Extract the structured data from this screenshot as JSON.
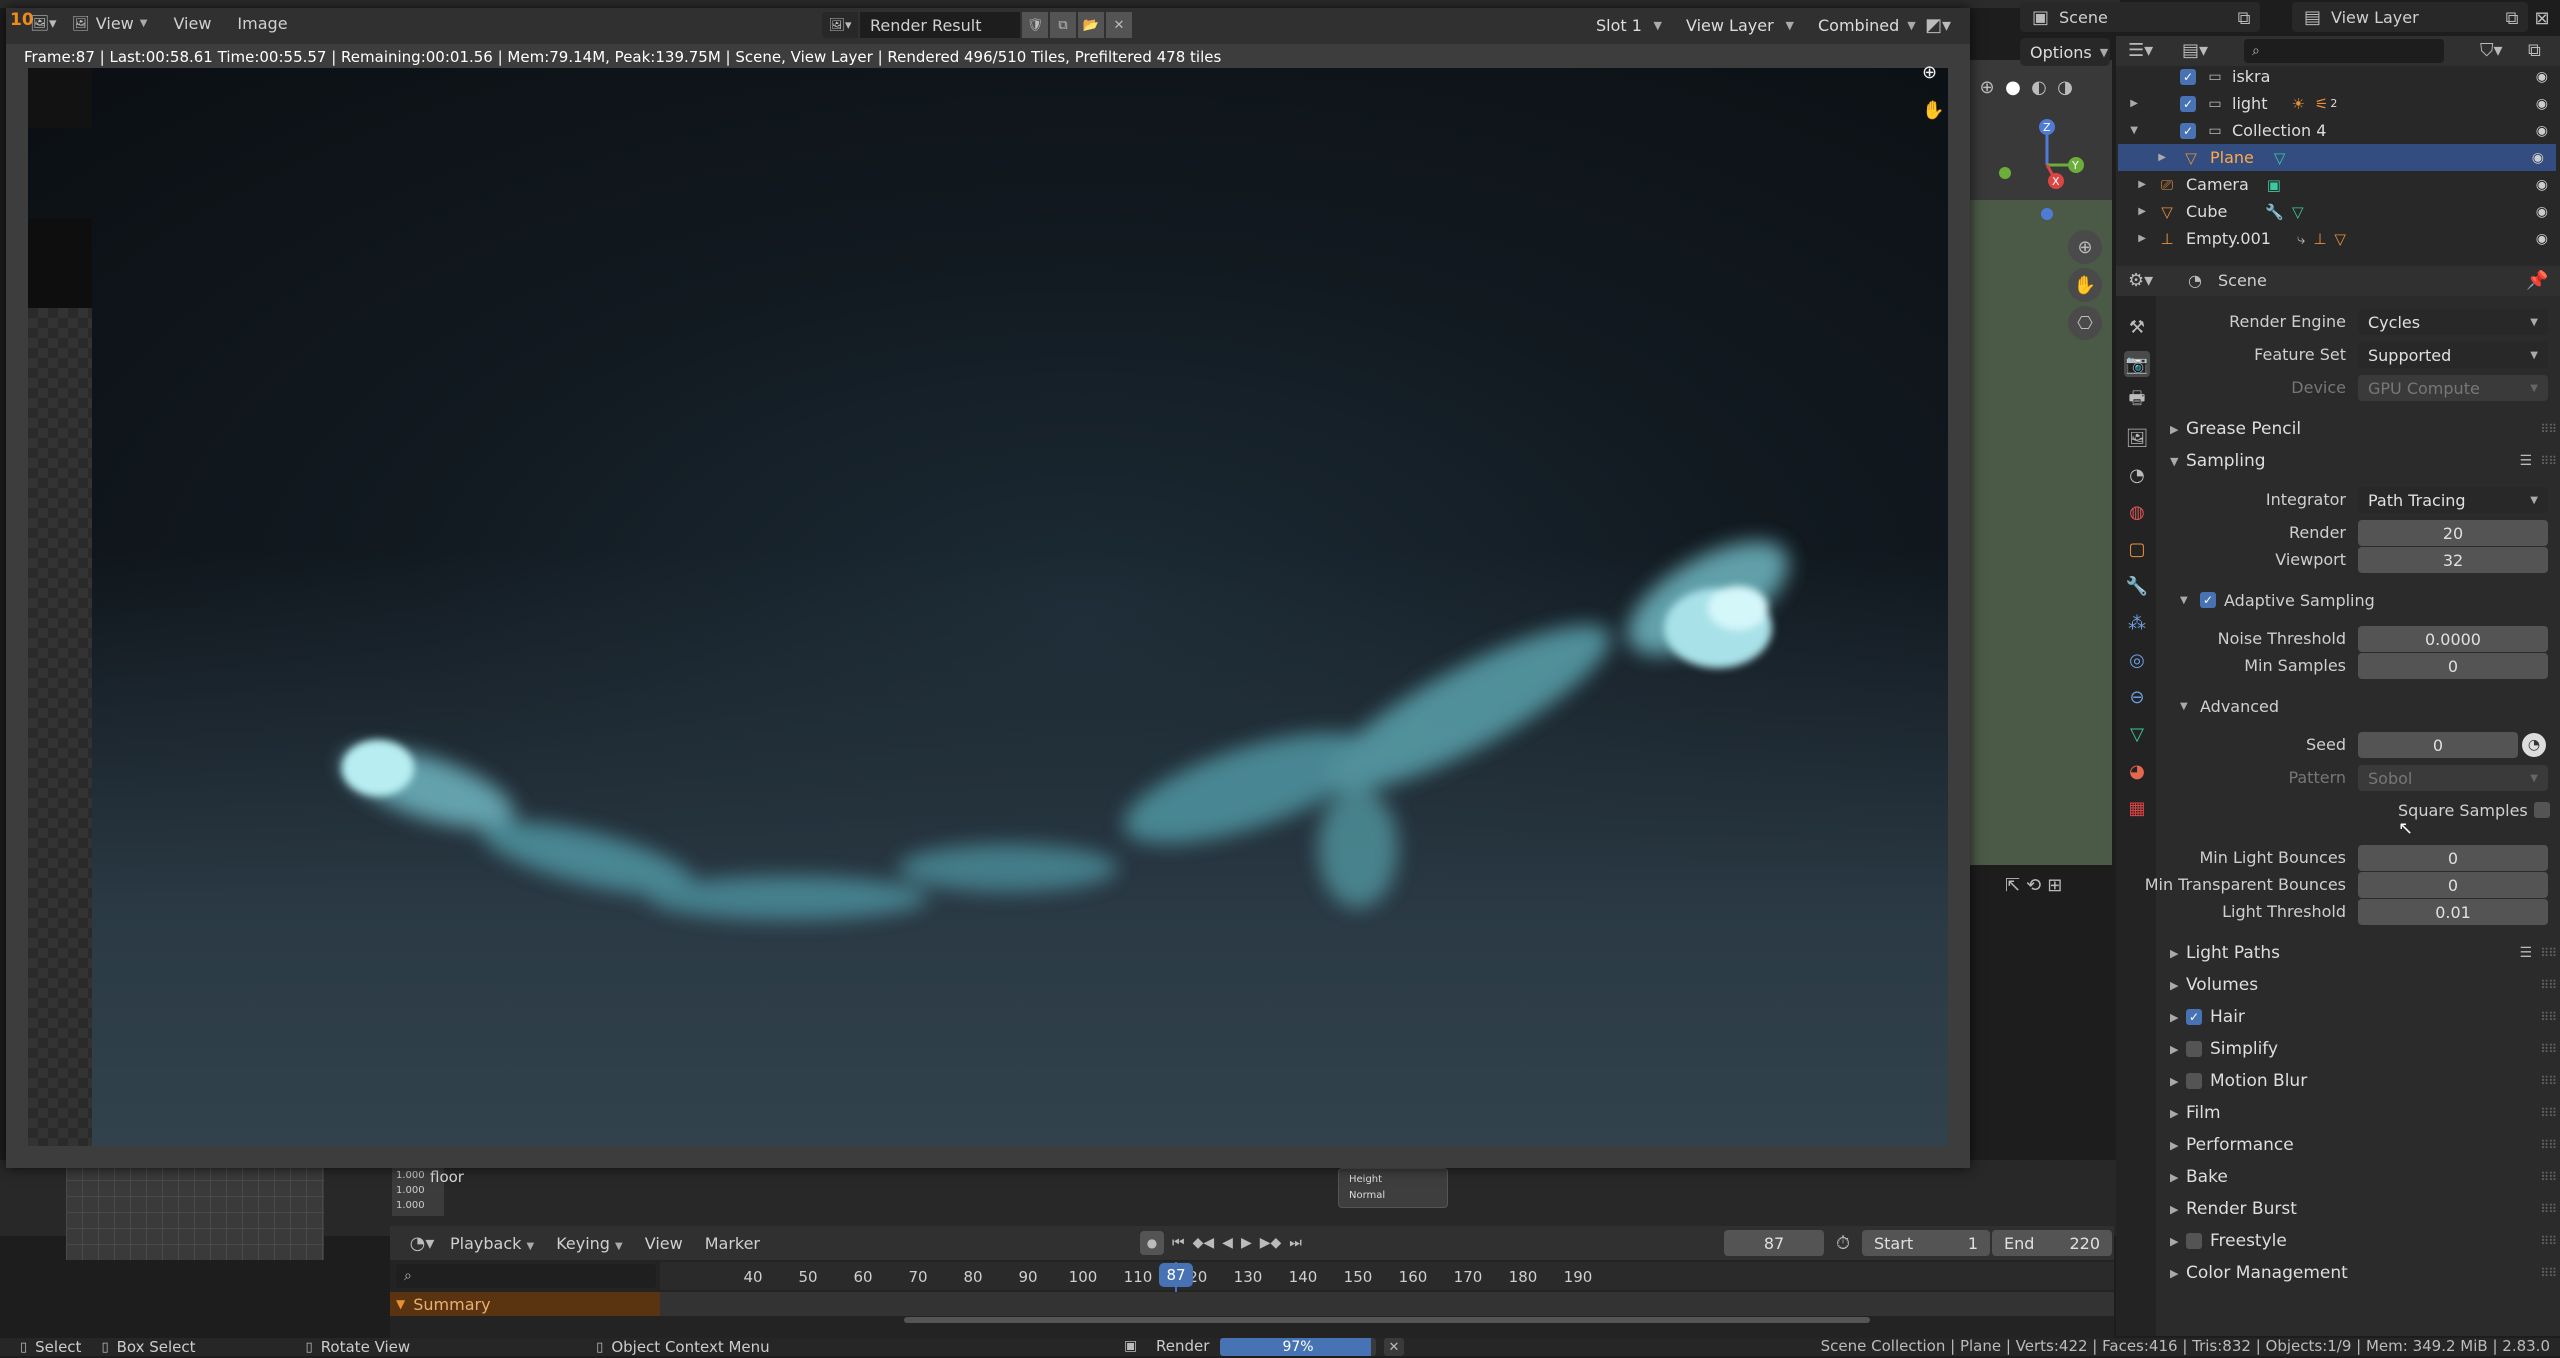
{
  "top_bar": {
    "scene_label": "Scene",
    "view_layer_label": "View Layer",
    "options_label": "Options"
  },
  "image_editor": {
    "menu": [
      "View",
      "View",
      "Image"
    ],
    "image_name": "Render Result",
    "slot": "Slot 1",
    "view_layer": "View Layer",
    "pass": "Combined",
    "status_line": "Frame:87 | Last:00:58.61 Time:00:55.57 | Remaining:00:01.56 | Mem:79.14M, Peak:139.75M | Scene, View Layer | Rendered 496/510 Tiles, Prefiltered 478 tiles",
    "frame_badge": "10"
  },
  "outliner": {
    "search_placeholder": "",
    "rows": [
      {
        "name": "iskra",
        "icon": "collection-icon"
      },
      {
        "name": "light",
        "icon": "collection-icon"
      },
      {
        "name": "Collection 4",
        "icon": "collection-icon"
      },
      {
        "name": "Plane",
        "icon": "mesh-icon"
      },
      {
        "name": "Camera",
        "icon": "camera-icon"
      },
      {
        "name": "Cube",
        "icon": "mesh-icon"
      },
      {
        "name": "Empty.001",
        "icon": "empty-icon"
      }
    ],
    "light_count": "2"
  },
  "properties": {
    "header": "Scene",
    "render_engine_label": "Render Engine",
    "render_engine": "Cycles",
    "feature_set_label": "Feature Set",
    "feature_set": "Supported",
    "device_label": "Device",
    "device": "GPU Compute",
    "sections_top": {
      "grease_pencil": "Grease Pencil",
      "sampling": "Sampling"
    },
    "integrator_label": "Integrator",
    "integrator": "Path Tracing",
    "render_label": "Render",
    "render_samples": "20",
    "viewport_label": "Viewport",
    "viewport_samples": "32",
    "adaptive_sampling": "Adaptive Sampling",
    "noise_threshold_label": "Noise Threshold",
    "noise_threshold": "0.0000",
    "min_samples_label": "Min Samples",
    "min_samples": "0",
    "advanced": "Advanced",
    "seed_label": "Seed",
    "seed": "0",
    "pattern_label": "Pattern",
    "pattern": "Sobol",
    "square_samples": "Square Samples",
    "min_light_bounces_label": "Min Light Bounces",
    "min_light_bounces": "0",
    "min_transparent_bounces_label": "Min Transparent Bounces",
    "min_transparent_bounces": "0",
    "light_threshold_label": "Light Threshold",
    "light_threshold": "0.01",
    "sections": [
      "Light Paths",
      "Volumes",
      "Hair",
      "Simplify",
      "Motion Blur",
      "Film",
      "Performance",
      "Bake",
      "Render Burst",
      "Freestyle",
      "Color Management"
    ]
  },
  "node_editor": {
    "node_label": "floor",
    "values": [
      "1.000",
      "1.000",
      "1.000"
    ],
    "socket_height": "Height",
    "socket_normal": "Normal"
  },
  "timeline": {
    "menus": [
      "Playback",
      "Keying",
      "View",
      "Marker"
    ],
    "current_frame": "87",
    "start_label": "Start",
    "start": "1",
    "end_label": "End",
    "end": "220",
    "ticks": [
      "40",
      "50",
      "60",
      "70",
      "80",
      "90",
      "100",
      "110",
      "120",
      "130",
      "140",
      "150",
      "160",
      "170",
      "180",
      "190"
    ],
    "playhead": "87",
    "summary": "Summary"
  },
  "status_bar": {
    "select": "Select",
    "box_select": "Box Select",
    "rotate_view": "Rotate View",
    "context_menu": "Object Context Menu",
    "render_label": "Render",
    "progress": "97%",
    "progress_value": 0.97,
    "stats": "Scene Collection | Plane | Verts:422 | Faces:416 | Tris:832 | Objects:1/9 | Mem: 349.2 MiB | 2.83.0"
  }
}
